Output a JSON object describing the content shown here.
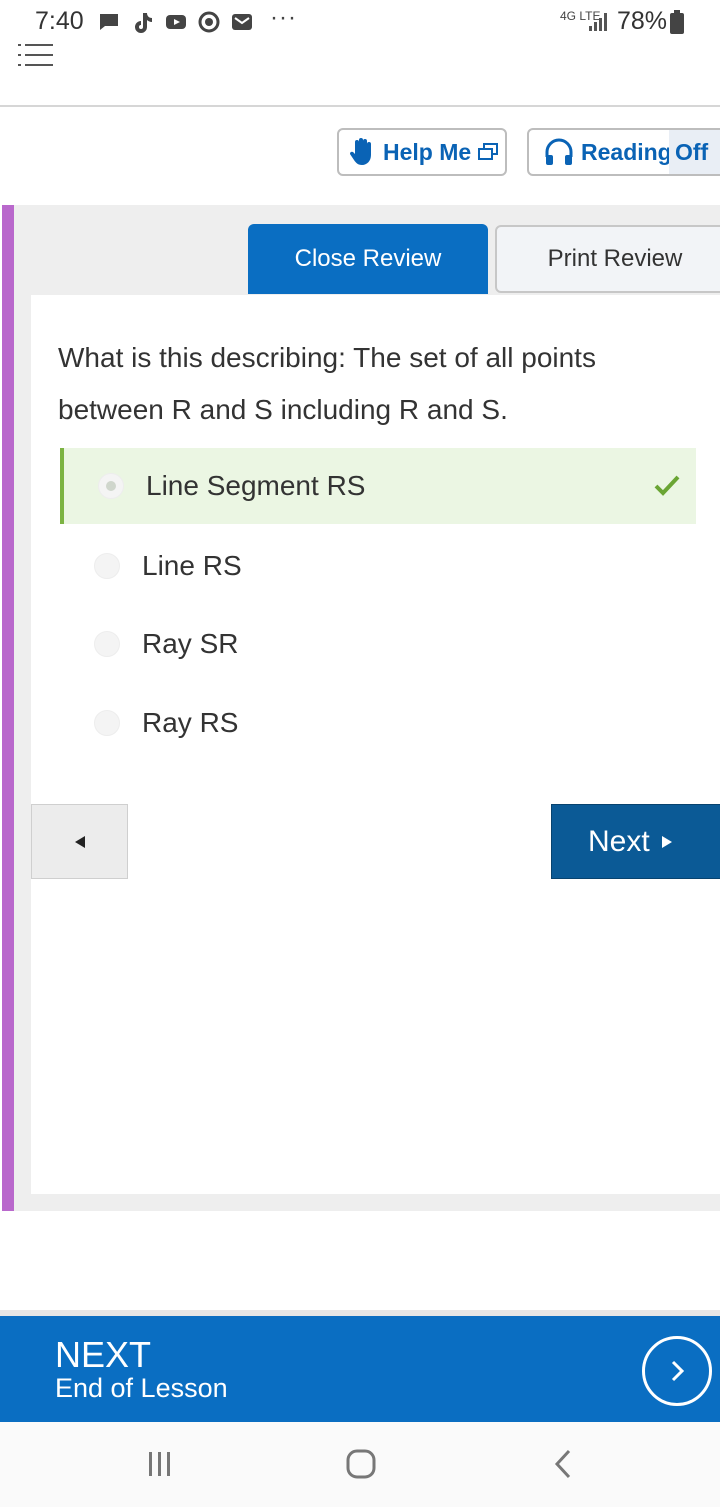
{
  "status_bar": {
    "time": "7:40",
    "overflow": "···",
    "network": "4G LTE",
    "battery": "78%",
    "icons": [
      "message-icon",
      "tiktok-icon",
      "youtube-icon",
      "settings-icon",
      "mail-icon",
      "signal-icon",
      "battery-icon"
    ]
  },
  "toolbar": {
    "help_label": "Help Me",
    "reading_label": "Reading",
    "reading_state": "Off"
  },
  "review": {
    "close_label": "Close Review",
    "print_label": "Print Review"
  },
  "question": {
    "text": "What is this describing: The set of all points between R and S including R and S.",
    "options": [
      {
        "label": "Line Segment RS",
        "selected": true,
        "correct": true
      },
      {
        "label": "Line RS",
        "selected": false
      },
      {
        "label": "Ray SR",
        "selected": false
      },
      {
        "label": "Ray RS",
        "selected": false
      }
    ]
  },
  "navigation": {
    "next_label": "Next"
  },
  "banner": {
    "title": "NEXT",
    "subtitle": "End of Lesson"
  },
  "colors": {
    "accent": "#0a6ec2",
    "next_button": "#0b5a96",
    "correct_bg": "#ebf6e3",
    "correct_mark": "#6aa534",
    "purple_bar": "#b968cc"
  }
}
